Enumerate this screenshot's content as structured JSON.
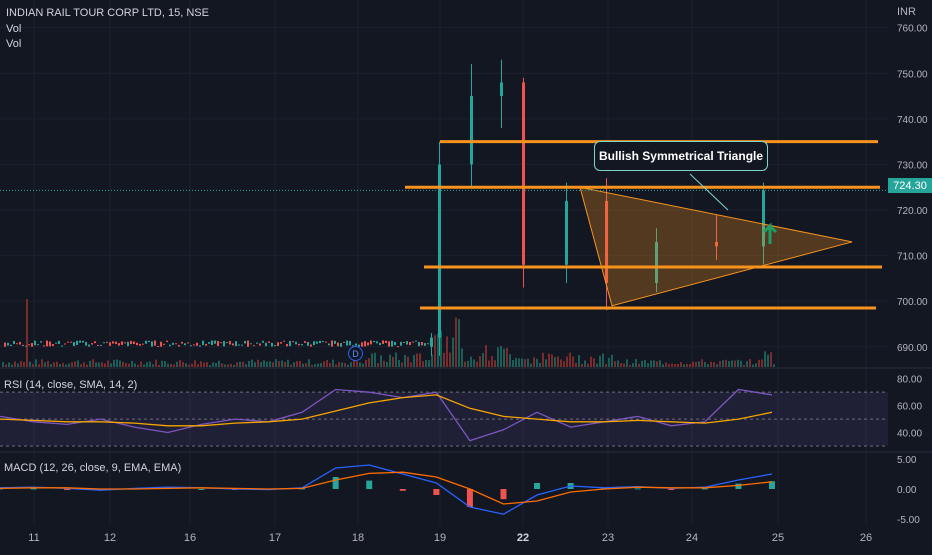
{
  "legend": {
    "symbol": "INDIAN RAIL TOUR CORP LTD, 15, NSE",
    "vol1": "Vol",
    "vol2": "Vol"
  },
  "currency": "INR",
  "last_price": "724.30",
  "annotation": "Bullish Symmetrical Triangle",
  "event_badge": "D",
  "rsi_label": "RSI (14, close, SMA, 14, 2)",
  "macd_label": "MACD (12, 26, close, 9, EMA, EMA)",
  "colors": {
    "background": "#131722",
    "up": "#26a69a",
    "down": "#ef5350",
    "level_line": "#f7931e",
    "rsi": "#7e57c2",
    "rsi_ma": "#f7a600",
    "macd_line": "#2962ff",
    "signal_line": "#ff6d00"
  },
  "chart_data": [
    {
      "type": "candlestick",
      "title": "INDIAN RAIL TOUR CORP LTD, 15, NSE",
      "x_labels": [
        "11",
        "12",
        "16",
        "17",
        "18",
        "19",
        "22",
        "23",
        "24",
        "25",
        "26"
      ],
      "y_ticks": [
        690,
        700,
        710,
        720,
        730,
        740,
        750,
        760
      ],
      "ylim": [
        686,
        763
      ],
      "last_price": 724.3,
      "series": [
        {
          "date": "18",
          "open": 690,
          "high": 693,
          "low": 688,
          "close": 692
        },
        {
          "date": "19",
          "open": 692,
          "high": 735,
          "low": 688,
          "close": 730
        },
        {
          "date": "19",
          "open": 730,
          "high": 752,
          "low": 725,
          "close": 745
        },
        {
          "date": "19",
          "open": 745,
          "high": 753,
          "low": 738,
          "close": 748
        },
        {
          "date": "22",
          "open": 748,
          "high": 749,
          "low": 703,
          "close": 708
        },
        {
          "date": "22",
          "open": 708,
          "high": 726,
          "low": 704,
          "close": 722
        },
        {
          "date": "23",
          "open": 722,
          "high": 727,
          "low": 698,
          "close": 704
        },
        {
          "date": "23",
          "open": 704,
          "high": 716,
          "low": 702,
          "close": 713
        },
        {
          "date": "24",
          "open": 713,
          "high": 719,
          "low": 709,
          "close": 712
        },
        {
          "date": "24",
          "open": 712,
          "high": 726,
          "low": 708,
          "close": 724.3
        }
      ],
      "horizontal_levels": [
        735,
        725,
        707.5,
        698.5
      ],
      "pattern": {
        "name": "Bullish Symmetrical Triangle",
        "apex_price": 713
      }
    },
    {
      "type": "line",
      "title": "RSI (14, close, SMA, 14, 2)",
      "y_ticks": [
        40,
        60,
        80
      ],
      "ylim": [
        27,
        85
      ],
      "band": [
        30,
        70
      ],
      "series": [
        {
          "name": "RSI",
          "values": [
            52,
            48,
            46,
            50,
            44,
            40,
            46,
            50,
            48,
            55,
            72,
            70,
            66,
            70,
            34,
            42,
            55,
            44,
            48,
            52,
            45,
            48,
            72,
            68
          ]
        },
        {
          "name": "RSI-based MA",
          "values": [
            50,
            49,
            48,
            48,
            47,
            45,
            45,
            47,
            48,
            50,
            56,
            62,
            66,
            68,
            58,
            52,
            50,
            48,
            48,
            49,
            48,
            47,
            50,
            55
          ]
        }
      ]
    },
    {
      "type": "bar",
      "title": "MACD (12, 26, close, 9, EMA, EMA)",
      "y_ticks": [
        -5.0,
        0.0,
        5.0
      ],
      "ylim": [
        -5.5,
        5.5
      ],
      "series": [
        {
          "name": "MACD",
          "values": [
            0.2,
            0.3,
            0.1,
            -0.2,
            0.1,
            0.3,
            0.2,
            0.0,
            -0.1,
            0.2,
            3.5,
            4.0,
            2.5,
            1.0,
            -3.0,
            -4.2,
            -1.0,
            0.5,
            0.2,
            0.4,
            0.1,
            0.3,
            1.5,
            2.5
          ]
        },
        {
          "name": "Signal",
          "values": [
            0.1,
            0.2,
            0.2,
            0.0,
            0.0,
            0.1,
            0.2,
            0.1,
            0.0,
            0.1,
            1.5,
            2.6,
            2.8,
            2.0,
            0.0,
            -2.5,
            -2.0,
            -0.5,
            0.0,
            0.3,
            0.2,
            0.2,
            0.6,
            1.2
          ]
        },
        {
          "name": "Histogram",
          "values": [
            0.1,
            0.1,
            -0.1,
            -0.2,
            0.1,
            0.2,
            0.0,
            -0.1,
            -0.1,
            0.1,
            2.0,
            1.4,
            -0.3,
            -1.0,
            -3.0,
            -1.7,
            1.0,
            1.0,
            0.2,
            0.1,
            -0.1,
            0.1,
            0.9,
            1.3
          ]
        }
      ]
    }
  ]
}
